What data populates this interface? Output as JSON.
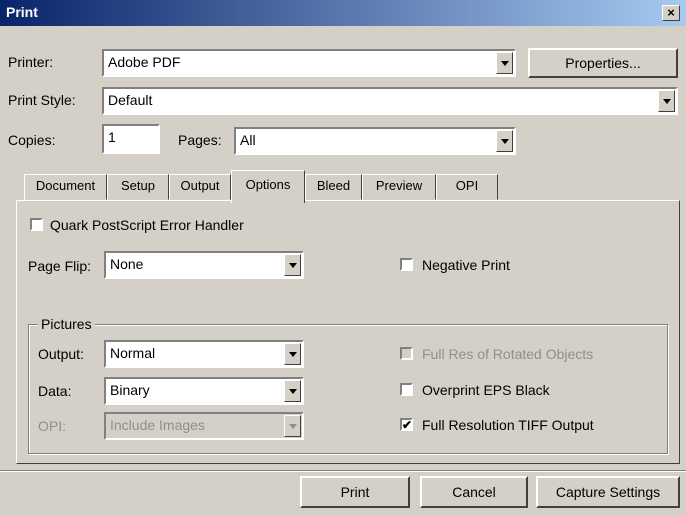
{
  "window": {
    "title": "Print"
  },
  "printer": {
    "label": "Printer:",
    "value": "Adobe PDF",
    "properties_button": "Properties..."
  },
  "print_style": {
    "label": "Print Style:",
    "value": "Default"
  },
  "copies": {
    "label": "Copies:",
    "value": "1"
  },
  "pages": {
    "label": "Pages:",
    "value": "All"
  },
  "tabs": [
    {
      "label": "Document"
    },
    {
      "label": "Setup"
    },
    {
      "label": "Output"
    },
    {
      "label": "Options",
      "active": true
    },
    {
      "label": "Bleed"
    },
    {
      "label": "Preview"
    },
    {
      "label": "OPI"
    }
  ],
  "options": {
    "quark_error_handler": {
      "label": "Quark PostScript Error Handler",
      "checked": false
    },
    "page_flip": {
      "label": "Page Flip:",
      "value": "None"
    },
    "negative_print": {
      "label": "Negative Print",
      "checked": false
    }
  },
  "pictures": {
    "group_title": "Pictures",
    "output": {
      "label": "Output:",
      "value": "Normal"
    },
    "data": {
      "label": "Data:",
      "value": "Binary"
    },
    "opi": {
      "label": "OPI:",
      "value": "Include Images",
      "disabled": true
    },
    "full_res_rotated": {
      "label": "Full Res of Rotated Objects",
      "checked": false,
      "disabled": true
    },
    "overprint_eps": {
      "label": "Overprint EPS Black",
      "checked": false
    },
    "full_res_tiff": {
      "label": "Full Resolution TIFF Output",
      "checked": true
    }
  },
  "buttons": {
    "print": "Print",
    "cancel": "Cancel",
    "capture": "Capture Settings"
  },
  "glyphs": {
    "close": "×",
    "check": "✔"
  }
}
